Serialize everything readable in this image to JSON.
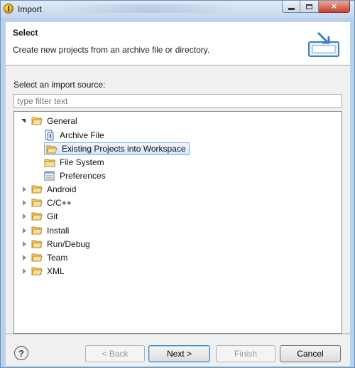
{
  "window": {
    "title": "Import",
    "close_symbol": "✕"
  },
  "header": {
    "title": "Select",
    "description": "Create new projects from an archive file or directory.",
    "icon": "import-wizard-icon"
  },
  "content": {
    "source_label": "Select an import source:",
    "filter_placeholder": "type filter text"
  },
  "tree": {
    "general": {
      "label": "General",
      "expanded": true,
      "children": [
        {
          "label": "Archive File",
          "icon": "archive-file-icon"
        },
        {
          "label": "Existing Projects into Workspace",
          "icon": "open-folder-icon",
          "selected": true
        },
        {
          "label": "File System",
          "icon": "folder-icon"
        },
        {
          "label": "Preferences",
          "icon": "preferences-icon"
        }
      ]
    },
    "collapsed": [
      {
        "label": "Android"
      },
      {
        "label": "C/C++"
      },
      {
        "label": "Git"
      },
      {
        "label": "Install"
      },
      {
        "label": "Run/Debug"
      },
      {
        "label": "Team"
      },
      {
        "label": "XML"
      }
    ]
  },
  "footer": {
    "help_symbol": "?",
    "back_label": "< Back",
    "next_label": "Next >",
    "finish_label": "Finish",
    "cancel_label": "Cancel"
  },
  "colors": {
    "selection_border": "#84acdd",
    "selection_fill": "#d5e5f8",
    "folder": "#e8b84a"
  }
}
